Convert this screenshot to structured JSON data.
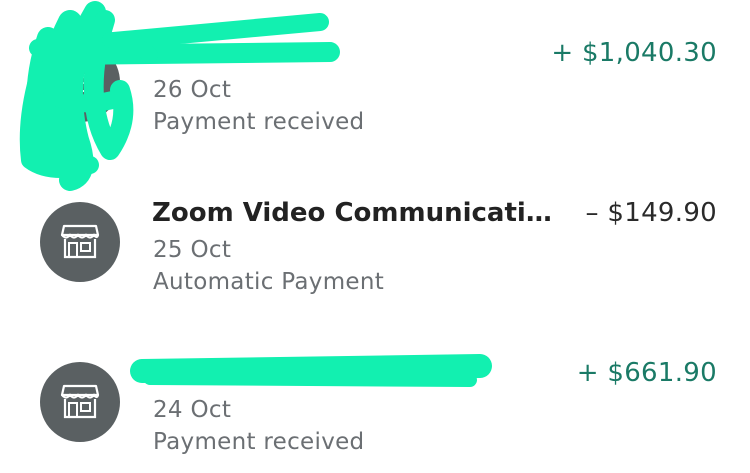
{
  "transactions": [
    {
      "name": "",
      "date": "26 Oct",
      "status": "Payment received",
      "amount": "+ $1,040.30",
      "direction": "credit",
      "icon": "store-icon",
      "name_redacted": true,
      "avatar_redacted": true
    },
    {
      "name": "Zoom Video Communicatio…",
      "date": "25 Oct",
      "status": "Automatic Payment",
      "amount": "– $149.90",
      "direction": "debit",
      "icon": "store-icon",
      "name_redacted": false,
      "avatar_redacted": false
    },
    {
      "name": "",
      "date": "24 Oct",
      "status": "Payment received",
      "amount": "+ $661.90",
      "direction": "credit",
      "icon": "store-icon",
      "name_redacted": true,
      "avatar_redacted": false
    }
  ],
  "colors": {
    "credit": "#1a7a66",
    "debit": "#2a2a2a",
    "secondary_text": "#6b6f73",
    "avatar_bg": "#5a6062",
    "redaction_marker": "#12f0b0"
  }
}
